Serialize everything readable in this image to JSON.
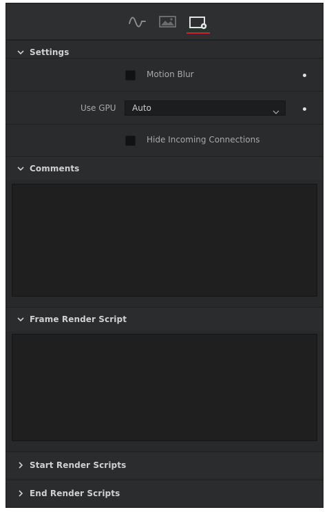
{
  "tabs": [
    {
      "name": "controls",
      "icon": "waveform-icon",
      "active": false
    },
    {
      "name": "image",
      "icon": "image-icon",
      "active": false
    },
    {
      "name": "settings",
      "icon": "settings-tab-icon",
      "active": true
    }
  ],
  "colors": {
    "panel_bg": "#28292b",
    "text": "#c8c8c8",
    "active_tab_underline": "#d1242a",
    "textarea_bg": "#1f1f20"
  },
  "settings": {
    "header": "Settings",
    "motion_blur_label": "Motion Blur",
    "motion_blur_checked": false,
    "use_gpu_label": "Use GPU",
    "use_gpu_value": "Auto",
    "hide_incoming_label": "Hide Incoming Connections",
    "hide_incoming_checked": false
  },
  "comments": {
    "header": "Comments",
    "value": ""
  },
  "frame_render_script": {
    "header": "Frame Render Script",
    "value": ""
  },
  "start_render_scripts": {
    "header": "Start Render Scripts"
  },
  "end_render_scripts": {
    "header": "End Render Scripts"
  }
}
